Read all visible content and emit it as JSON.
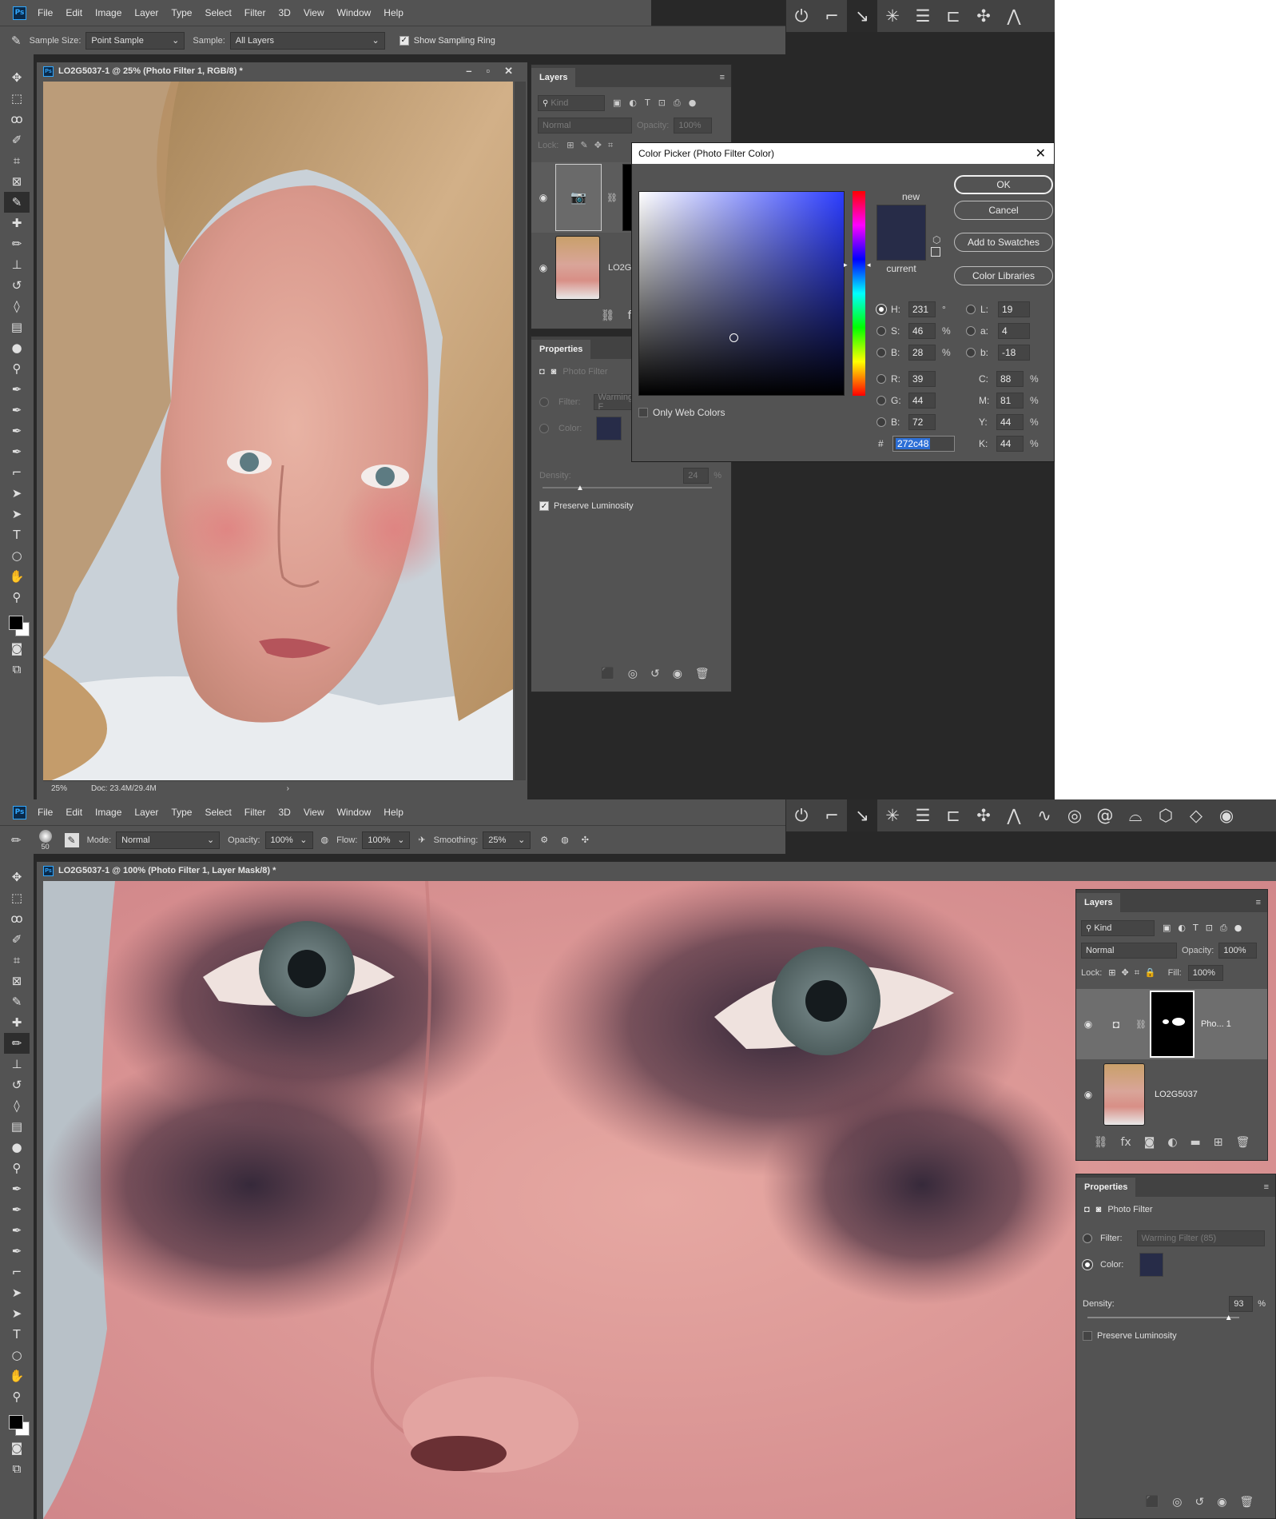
{
  "app": {
    "logo": "Ps"
  },
  "menu": [
    "File",
    "Edit",
    "Image",
    "Layer",
    "Type",
    "Select",
    "Filter",
    "3D",
    "View",
    "Window",
    "Help"
  ],
  "top_toolbar_icons": [
    "power-icon",
    "step-icon",
    "curve-icon",
    "star-icon",
    "lines-icon",
    "bracket-icon",
    "cross-icon",
    "triangle-icon",
    "wave-icon",
    "spiral-icon",
    "swirl-icon",
    "hat-icon",
    "cube-icon",
    "diamond-icon",
    "ring-icon"
  ],
  "shot1": {
    "options": {
      "sample_size_label": "Sample Size:",
      "sample_size_value": "Point Sample",
      "sample_label": "Sample:",
      "sample_value": "All Layers",
      "ring_label": "Show Sampling Ring"
    },
    "doc_title": "LO2G5037-1 @ 25% (Photo Filter 1, RGB/8) *",
    "zoom": "25%",
    "doc_info": "Doc: 23.4M/29.4M",
    "layers": {
      "tab": "Layers",
      "kind": "Kind",
      "blend": "Normal",
      "opacity_label": "Opacity:",
      "opacity": "100%",
      "lock_label": "Lock:",
      "layer2_name": "LO2G"
    },
    "properties": {
      "tab": "Properties",
      "type": "Photo Filter",
      "filter_label": "Filter:",
      "filter_value": "Warming F",
      "color_label": "Color:",
      "density_label": "Density:",
      "density": "24",
      "pct": "%",
      "preserve": "Preserve Luminosity"
    },
    "picker": {
      "title": "Color Picker (Photo Filter Color)",
      "new_label": "new",
      "current_label": "current",
      "ok": "OK",
      "cancel": "Cancel",
      "add_swatch": "Add to Swatches",
      "libraries": "Color Libraries",
      "only_web": "Only Web Colors",
      "H": "231",
      "S": "46",
      "Bv": "28",
      "R": "39",
      "G": "44",
      "Bc": "72",
      "L": "19",
      "a": "4",
      "b": "-18",
      "C": "88",
      "M": "81",
      "Y": "44",
      "K": "44",
      "hex": "272c48",
      "deg": "°",
      "pct": "%",
      "hash": "#",
      "lbl_H": "H:",
      "lbl_S": "S:",
      "lbl_B": "B:",
      "lbl_R": "R:",
      "lbl_G": "G:",
      "lbl_Bc": "B:",
      "lbl_L": "L:",
      "lbl_a": "a:",
      "lbl_b": "b:",
      "lbl_C": "C:",
      "lbl_M": "M:",
      "lbl_Y": "Y:",
      "lbl_K": "K:",
      "color": "#272c48"
    }
  },
  "shot2": {
    "options": {
      "brush_size": "50",
      "mode_label": "Mode:",
      "mode_value": "Normal",
      "opacity_label": "Opacity:",
      "opacity": "100%",
      "flow_label": "Flow:",
      "flow": "100%",
      "smoothing_label": "Smoothing:",
      "smoothing": "25%"
    },
    "doc_title": "LO2G5037-1 @ 100% (Photo Filter 1, Layer Mask/8) *",
    "layers": {
      "tab": "Layers",
      "kind": "Kind",
      "blend": "Normal",
      "opacity_label": "Opacity:",
      "opacity": "100%",
      "lock_label": "Lock:",
      "fill_label": "Fill:",
      "fill": "100%",
      "layer1_name": "Pho... 1",
      "layer2_name": "LO2G5037"
    },
    "properties": {
      "tab": "Properties",
      "type": "Photo Filter",
      "filter_label": "Filter:",
      "filter_value": "Warming Filter (85)",
      "color_label": "Color:",
      "density_label": "Density:",
      "density": "93",
      "density_fraction": 0.93,
      "pct": "%",
      "preserve": "Preserve Luminosity"
    }
  }
}
